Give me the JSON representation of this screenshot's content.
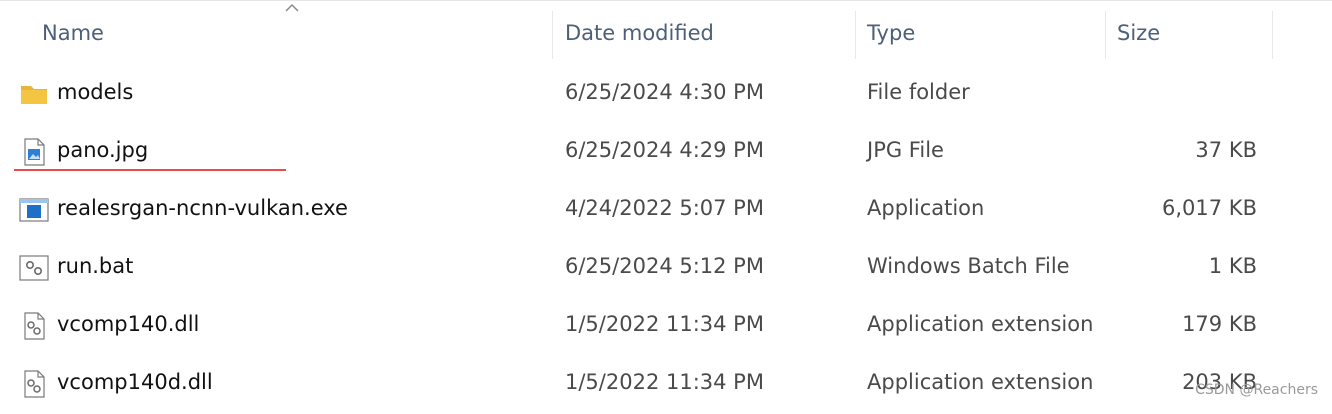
{
  "columns": {
    "name": "Name",
    "date": "Date modified",
    "type": "Type",
    "size": "Size"
  },
  "files": [
    {
      "name": "models",
      "date": "6/25/2024 4:30 PM",
      "type": "File folder",
      "size": "",
      "icon": "folder-icon"
    },
    {
      "name": "pano.jpg",
      "date": "6/25/2024 4:29 PM",
      "type": "JPG File",
      "size": "37 KB",
      "icon": "image-file-icon"
    },
    {
      "name": "realesrgan-ncnn-vulkan.exe",
      "date": "4/24/2022 5:07 PM",
      "type": "Application",
      "size": "6,017 KB",
      "icon": "application-icon"
    },
    {
      "name": "run.bat",
      "date": "6/25/2024 5:12 PM",
      "type": "Windows Batch File",
      "size": "1 KB",
      "icon": "batch-file-icon"
    },
    {
      "name": "vcomp140.dll",
      "date": "1/5/2022 11:34 PM",
      "type": "Application extension",
      "size": "179 KB",
      "icon": "dll-file-icon"
    },
    {
      "name": "vcomp140d.dll",
      "date": "1/5/2022 11:34 PM",
      "type": "Application extension",
      "size": "203 KB",
      "icon": "dll-file-icon"
    }
  ],
  "watermark": "CSDN @Reachers",
  "colors": {
    "accent_underline": "#e84d4d",
    "header_text": "#4c607a",
    "folder": "#f4c542"
  }
}
